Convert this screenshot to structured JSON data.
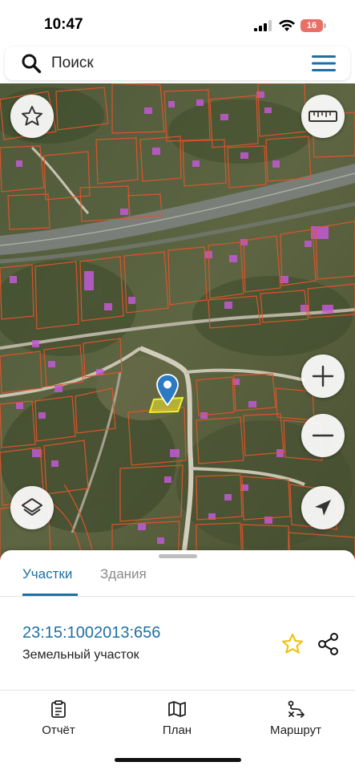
{
  "status_bar": {
    "time": "10:47",
    "battery": "16"
  },
  "search": {
    "placeholder": "Поиск"
  },
  "map": {
    "buttons": [
      "favorites-star",
      "ruler",
      "zoom-in",
      "zoom-out",
      "layers",
      "navigate-arrow"
    ],
    "colors": {
      "parcel_outline": "#e2552a",
      "building_highlight": "#c25ad4",
      "selected_parcel": "#f2ef2a"
    }
  },
  "sheet": {
    "tabs": [
      {
        "label": "Участки",
        "active": true
      },
      {
        "label": "Здания",
        "active": false
      }
    ],
    "parcel": {
      "cadastral_number": "23:15:1002013:656",
      "type": "Земельный участок"
    }
  },
  "bottom_nav": {
    "items": [
      {
        "label": "Отчёт",
        "icon": "report-icon"
      },
      {
        "label": "План",
        "icon": "map-plan-icon"
      },
      {
        "label": "Маршрут",
        "icon": "route-icon"
      }
    ]
  },
  "theme": {
    "accent": "#1d6fa5",
    "star": "#f0c21b"
  }
}
